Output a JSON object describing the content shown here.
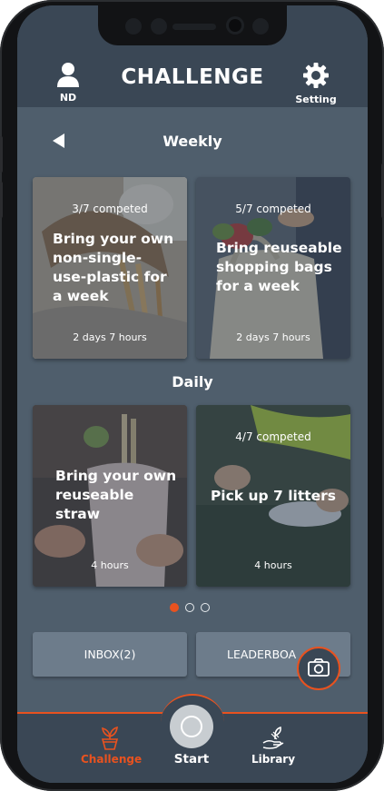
{
  "header": {
    "title": "CHALLENGE",
    "profile_label": "ND",
    "setting_label": "Setting"
  },
  "icons": {
    "profile": "user-icon",
    "settings": "gear-icon",
    "back": "triangle-left-icon",
    "camera": "camera-icon",
    "challenge_tab": "plant-pot-icon",
    "library_tab": "hand-plant-icon"
  },
  "weekly": {
    "title": "Weekly",
    "cards": [
      {
        "progress": "3/7 competed",
        "title": "Bring your own non-single-use-plastic for a week",
        "time": "2 days 7 hours"
      },
      {
        "progress": "5/7 competed",
        "title": "Bring reuseable shopping bags for a week",
        "time": "2 days 7 hours"
      }
    ]
  },
  "daily": {
    "title": "Daily",
    "cards": [
      {
        "progress": "",
        "title": "Bring your own reuseable straw",
        "time": "4 hours"
      },
      {
        "progress": "4/7 competed",
        "title": "Pick up 7 litters",
        "time": "4 hours"
      }
    ]
  },
  "pagination": {
    "active_index": 0,
    "total": 3
  },
  "buttons": {
    "inbox": "INBOX(2)",
    "leaderboard": "LEADERBOA"
  },
  "tabbar": {
    "challenge": "Challenge",
    "start": "Start",
    "library": "Library",
    "active": "challenge"
  },
  "colors": {
    "accent": "#e8521f",
    "header_bg": "#3a4755",
    "screen_bg": "#4f5e6c",
    "button_bg": "#6d7c8b"
  }
}
